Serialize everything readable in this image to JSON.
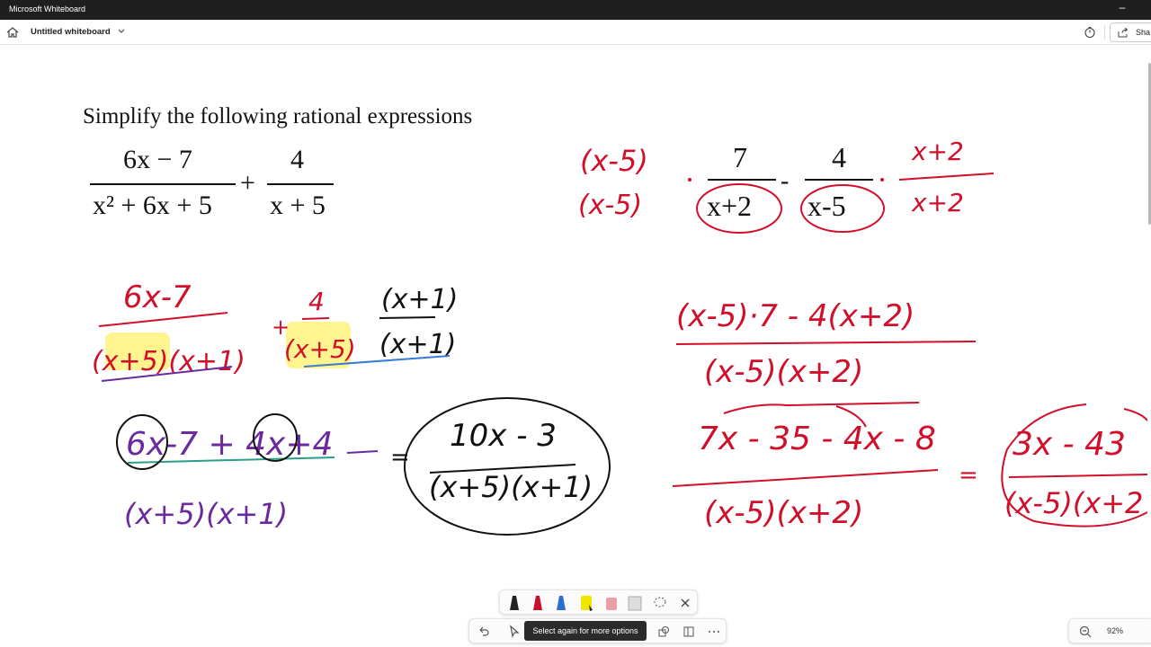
{
  "window": {
    "app_title": "Microsoft Whiteboard",
    "minimize": "–"
  },
  "appbar": {
    "board_title": "Untitled whiteboard",
    "share_label": "Sha"
  },
  "problem": {
    "title": "Simplify the following rational expressions",
    "term1_num": "6x − 7",
    "term1_den": "x² + 6x + 5",
    "plus": "+",
    "term2_num": "4",
    "term2_den": "x + 5"
  },
  "handwriting": {
    "colors": {
      "red": "#d0102b",
      "black": "#111111",
      "purple": "#6a2a9e",
      "highlight": "#fff27a"
    },
    "step1_top": {
      "lead_num": "(x-5)",
      "lead_den": "(x-5)",
      "frac1_num": "7",
      "frac1_den": "x+2",
      "minus": "-",
      "frac2_num": "4",
      "frac2_den": "x-5",
      "tail_num": "x+2",
      "tail_den": "x+2"
    },
    "step2_left": {
      "num1": "6x-7",
      "den1": "(x+5)(x+1)",
      "plus": "+",
      "num2": "4",
      "den2": "(x+5)",
      "mul_num": "(x+1)",
      "mul_den": "(x+1)"
    },
    "step3_left": {
      "numerator": "6x-7 + 4x+4",
      "denominator": "(x+5)(x+1)",
      "equals": "=",
      "answer_num": "10x - 3",
      "answer_den": "(x+5)(x+1)"
    },
    "step2_right": {
      "numerator": "(x-5)·7 - 4(x+2)",
      "denominator": "(x-5)(x+2)"
    },
    "step3_right": {
      "numerator": "7x - 35 - 4x - 8",
      "denominator": "(x-5)(x+2)",
      "equals": "=",
      "answer_num": "3x - 43",
      "answer_den": "(x-5)(x+2"
    }
  },
  "toolbar": {
    "pens": [
      "black-pen-icon",
      "red-pen-icon",
      "blue-pen-icon",
      "yellow-highlighter-icon",
      "eraser-icon",
      "ruler-icon",
      "lasso-select-icon",
      "close-icon"
    ],
    "tooltip": "Select again for more options",
    "zoom": "92%"
  }
}
